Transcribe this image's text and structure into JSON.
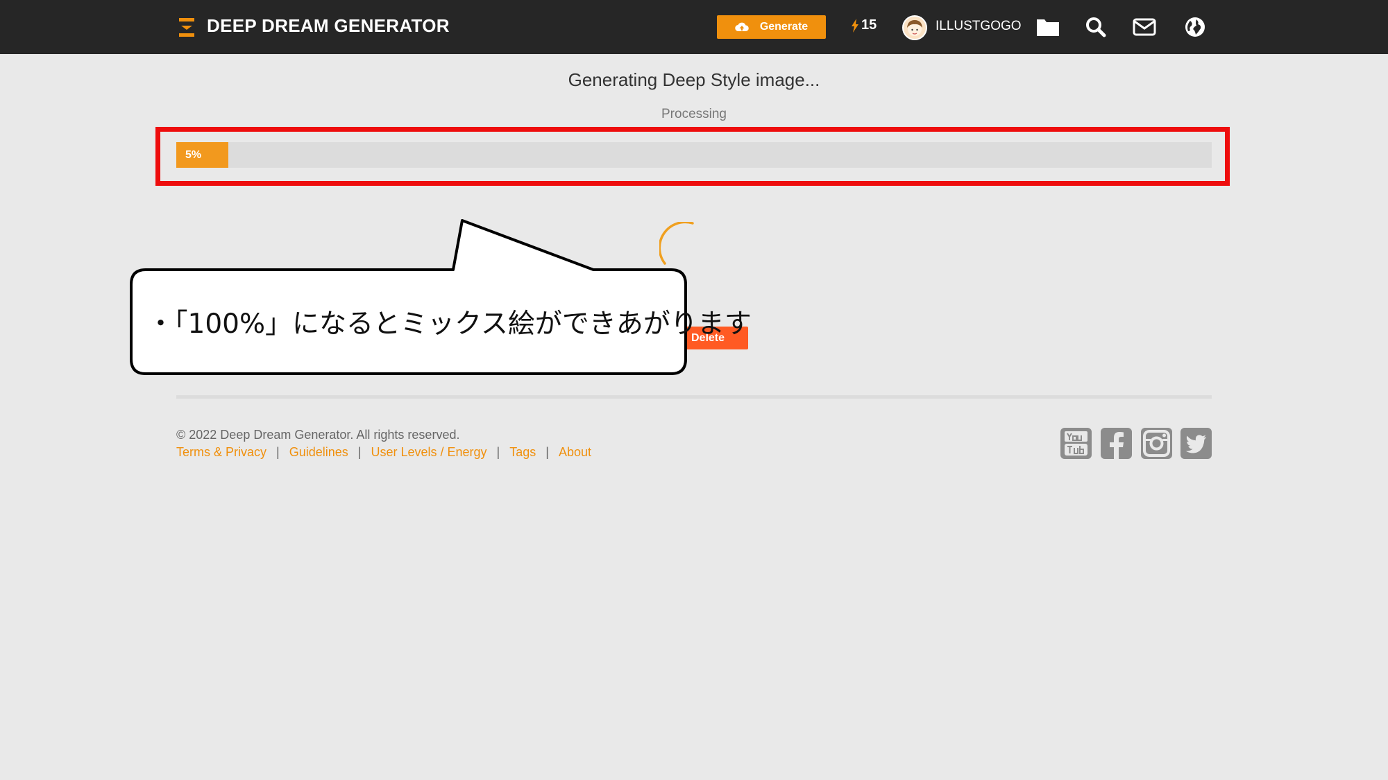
{
  "header": {
    "brand": "DEEP DREAM GENERATOR",
    "generate_label": "Generate",
    "energy": "15",
    "username": "ILLUSTGOGO"
  },
  "status": {
    "title": "Generating Deep Style image...",
    "subtitle": "Processing",
    "progress_percent": 5,
    "progress_label": "5%"
  },
  "actions": {
    "delete_label": "Delete"
  },
  "callout": {
    "text": "・「100%」になるとミックス絵ができあがります"
  },
  "footer": {
    "copyright": "© 2022 Deep Dream Generator. All rights reserved.",
    "links": [
      "Terms & Privacy",
      "Guidelines",
      "User Levels / Energy",
      "Tags",
      "About"
    ]
  },
  "social": [
    "youtube-icon",
    "facebook-icon",
    "instagram-icon",
    "twitter-icon"
  ],
  "colors": {
    "accent": "#f0900d",
    "progress": "#f2991e",
    "delete": "#ff5a23",
    "highlight": "#ee0d0d",
    "topbar": "#262626"
  }
}
